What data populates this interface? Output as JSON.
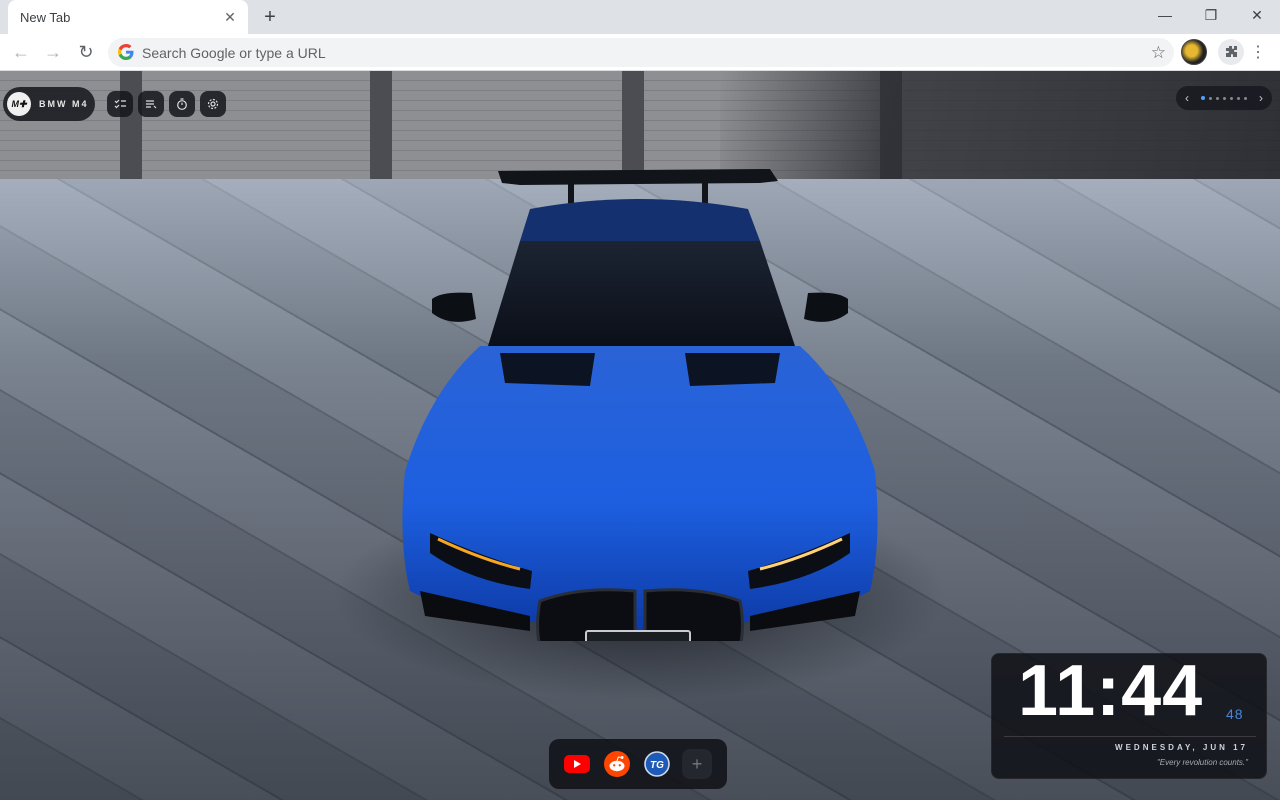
{
  "browser": {
    "tab_title": "New Tab",
    "omnibox_placeholder": "Search Google or type a URL"
  },
  "newtab": {
    "brand_label": "BMW M4",
    "brand_logo_text": "M",
    "tools": [
      "checklist-icon",
      "notes-icon",
      "timer-icon",
      "settings-icon"
    ],
    "wallpaper_pager": {
      "count": 7,
      "active": 1
    }
  },
  "clock": {
    "time": "11:44",
    "seconds": "48",
    "date": "WEDNESDAY, JUN 17",
    "quote": "\"Every revolution counts.\""
  },
  "dock": {
    "apps": [
      {
        "name": "youtube-icon",
        "color": "#ff0000"
      },
      {
        "name": "reddit-icon",
        "color": "#ff4500"
      },
      {
        "name": "tg-icon",
        "label": "TG",
        "color": "#1e5bb8"
      }
    ]
  },
  "colors": {
    "car_blue": "#1d5fe0",
    "accent_blue": "#4a86d8"
  }
}
